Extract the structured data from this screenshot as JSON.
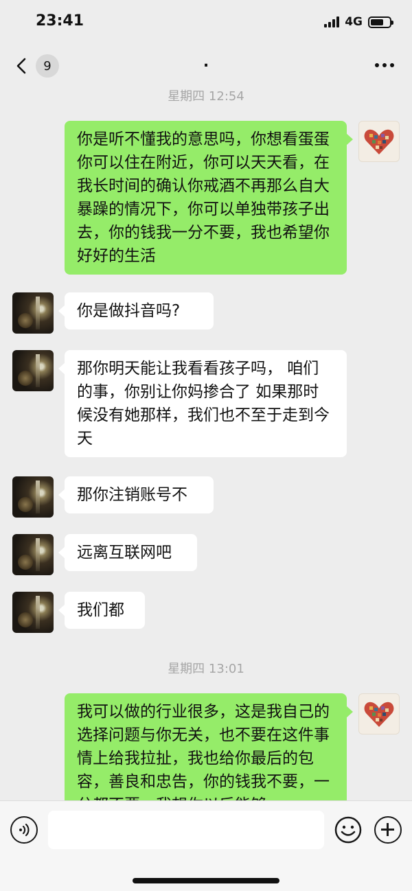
{
  "status": {
    "time": "23:41",
    "network": "4G"
  },
  "nav": {
    "unread_count": "9",
    "title": "."
  },
  "messages": [
    {
      "type": "timestamp",
      "text": "星期四 12:54"
    },
    {
      "type": "out",
      "text": "你是听不懂我的意思吗，你想看蛋蛋你可以住在附近，你可以天天看，在我长时间的确认你戒酒不再那么自大暴躁的情况下，你可以单独带孩子出去，你的钱我一分不要，我也希望你好好的生活"
    },
    {
      "type": "in",
      "text": "你是做抖音吗?"
    },
    {
      "type": "in",
      "text": "那你明天能让我看看孩子吗， 咱们的事，你别让你妈掺合了 如果那时候没有她那样，我们也不至于走到今天"
    },
    {
      "type": "in",
      "text": "那你注销账号不"
    },
    {
      "type": "in",
      "text": "远离互联网吧"
    },
    {
      "type": "in",
      "text": "我们都"
    },
    {
      "type": "timestamp",
      "text": "星期四 13:01"
    },
    {
      "type": "out",
      "text": "我可以做的行业很多，这是我自己的选择问题与你无关，也不要在这件事情上给我拉扯，我也给你最后的包容，善良和忠告，你的钱我不要，一分都不要，我想你以后能够"
    }
  ],
  "input": {
    "value": "",
    "placeholder": ""
  },
  "icons": {
    "back": "chevron-left-icon",
    "more": "more-horizontal-icon",
    "voice": "voice-icon",
    "emoji": "emoji-icon",
    "add": "plus-circle-icon"
  },
  "colors": {
    "outgoing_bubble": "#95ec69",
    "incoming_bubble": "#ffffff",
    "background": "#ededed"
  }
}
